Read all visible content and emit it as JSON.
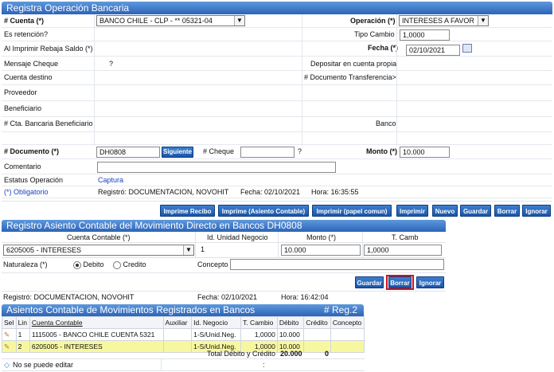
{
  "form": {
    "title": "Registra Operación Bancaria",
    "cuenta_label": "# Cuenta (*)",
    "cuenta_value": "BANCO CHILE - CLP - ** 05321-04",
    "operacion_label": "Operación (*)",
    "operacion_value": "INTERESES A FAVOR",
    "es_retencion_label": "Es retención?",
    "tipo_cambio_label": "Tipo Cambio",
    "tipo_cambio_value": "1,0000",
    "al_imprimir_label": "Al Imprimir Rebaja Saldo (*)",
    "fecha_label": "Fecha (*)",
    "fecha_value": "02/10/2021",
    "mensaje_cheque_label": "Mensaje Cheque",
    "question_mark": "?",
    "depositar_label": "Depositar en cuenta propia",
    "cuenta_destino_label": "Cuenta destino",
    "doc_transferencia_label": "# Documento Transferencia>",
    "proveedor_label": "Proveedor",
    "beneficiario_label": "Beneficiario",
    "cta_bancaria_label": "# Cta. Bancaria Beneficiario",
    "banco_label": "Banco",
    "documento_label": "# Documento (*)",
    "documento_value": "DH0808",
    "siguiente_label": "Siguiente",
    "cheque_label": "# Cheque",
    "cheque_question": "?",
    "monto_label": "Monto (*)",
    "monto_value": "10.000",
    "comentario_label": "Comentario",
    "estatus_label": "Estatus Operación",
    "estatus_value": "Captura",
    "obligatorio_label": "(*) Obligatorio",
    "registro_text": "Registró: DOCUMENTACION, NOVOHIT",
    "fecha_registro": "Fecha: 02/10/2021",
    "hora_registro": "Hora: 16:35:55"
  },
  "toolbar": {
    "buttons": [
      "Imprime Recibo",
      "Imprime (Asiento Contable)",
      "Imprimir (papel comun)",
      "Imprimir",
      "Nuevo",
      "Guardar",
      "Borrar",
      "Ignorar"
    ]
  },
  "asiento": {
    "title": "Registro Asiento Contable del Movimiento Directo en Bancos DH0808",
    "col_cuenta": "Cuenta Contable (*)",
    "col_unidad": "Id. Unidad Negocio",
    "col_monto": "Monto (*)",
    "col_tcamb": "T. Camb",
    "cuenta_value": "6205005 - INTERESES",
    "unidad_value": "1",
    "monto_value": "10.000",
    "tcamb_value": "1,0000",
    "naturaleza_label": "Naturaleza (*)",
    "debito_label": "Debito",
    "credito_label": "Credito",
    "concepto_label": "Concepto",
    "guardar_label": "Guardar",
    "borrar_label": "Borrar",
    "ignorar_label": "Ignorar",
    "registro_text": "Registró: DOCUMENTACION, NOVOHIT",
    "fecha_registro": "Fecha: 02/10/2021",
    "hora_registro": "Hora: 16:42:04"
  },
  "asientos_list": {
    "title": "Asientos Contable de Movimientos Registrados en Bancos",
    "reg_count": "# Reg.2",
    "headers": [
      "Sel",
      "Lin",
      "Cuenta Contable",
      "Auxiliar",
      "Id. Negocio",
      "T. Cambio",
      "Débito",
      "Crédito",
      "Concepto"
    ],
    "rows": [
      {
        "lin": "1",
        "cuenta": "1115005 - BANCO CHILE CUENTA 5321",
        "auxiliar": "",
        "negocio": "1-S/Unid.Neg.",
        "tcambio": "1,0000",
        "debito": "10.000",
        "credito": "",
        "concepto": ""
      },
      {
        "lin": "2",
        "cuenta": "6205005 - INTERESES",
        "auxiliar": "",
        "negocio": "1-S/Unid.Neg.",
        "tcambio": "1,0000",
        "debito": "10.000",
        "credito": "",
        "concepto": ""
      }
    ],
    "total_label": "Total Débito y Crédito",
    "total_debito": "20.000",
    "total_credito": "0",
    "footer_note": "No se puede editar",
    "footer_colon": ":"
  }
}
